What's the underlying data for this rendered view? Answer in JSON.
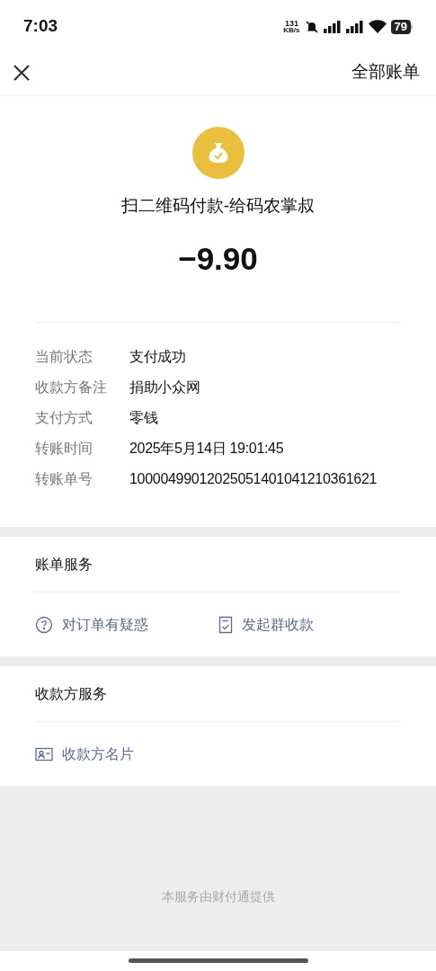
{
  "status_bar": {
    "time": "7:03",
    "speed_value": "131",
    "speed_unit": "KB/s",
    "battery": "79"
  },
  "nav": {
    "right_link": "全部账单"
  },
  "summary": {
    "title": "扫二维码付款-给码农掌叔",
    "amount": "−9.90"
  },
  "details": [
    {
      "label": "当前状态",
      "value": "支付成功"
    },
    {
      "label": "收款方备注",
      "value": "捐助小众网"
    },
    {
      "label": "支付方式",
      "value": "零钱"
    },
    {
      "label": "转账时间",
      "value": "2025年5月14日 19:01:45"
    },
    {
      "label": "转账单号",
      "value": "10000499012025051401041210361621"
    }
  ],
  "sections": [
    {
      "title": "账单服务",
      "items": [
        {
          "kind": "question",
          "label": "对订单有疑惑"
        },
        {
          "kind": "receipt",
          "label": "发起群收款"
        }
      ]
    },
    {
      "title": "收款方服务",
      "items": [
        {
          "kind": "card",
          "label": "收款方名片"
        }
      ]
    }
  ],
  "footer": "本服务由财付通提供"
}
